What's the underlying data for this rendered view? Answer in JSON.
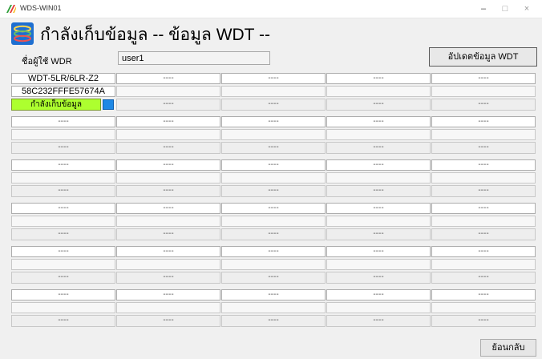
{
  "window": {
    "title": "WDS-WIN01",
    "minimize": "–",
    "maximize": "□",
    "close": "×"
  },
  "header": {
    "icon": "stacked-rings-icon",
    "title": "กำลังเก็บข้อมูล -- ข้อมูล WDT --"
  },
  "user": {
    "label": "ชื่อผู้ใช้ WDR",
    "value": "user1"
  },
  "toolbar": {
    "update_label": "อัปเดตข้อมูล WDT"
  },
  "status": {
    "collecting": "กำลังเก็บข้อมูล",
    "indicator_color": "#1e88e5",
    "bar_color": "#adff2f"
  },
  "devices": [
    [
      "WDT-5LR/6LR-Z2",
      "58C232FFFE57674A",
      ""
    ],
    [
      "----",
      "",
      "----"
    ],
    [
      "----",
      "",
      "----"
    ],
    [
      "----",
      "",
      "----"
    ],
    [
      "----",
      "",
      "----"
    ],
    [
      "----",
      "",
      "----"
    ],
    [
      "----",
      "",
      "----"
    ],
    [
      "----",
      "",
      "----"
    ],
    [
      "----",
      "",
      "----"
    ],
    [
      "----",
      "",
      "----"
    ],
    [
      "----",
      "",
      "----"
    ],
    [
      "----",
      "",
      "----"
    ],
    [
      "----",
      "",
      "----"
    ],
    [
      "----",
      "",
      "----"
    ],
    [
      "----",
      "",
      "----"
    ],
    [
      "----",
      "",
      "----"
    ],
    [
      "----",
      "",
      "----"
    ],
    [
      "----",
      "",
      "----"
    ],
    [
      "----",
      "",
      "----"
    ],
    [
      "----",
      "",
      "----"
    ],
    [
      "----",
      "",
      "----"
    ],
    [
      "----",
      "",
      "----"
    ],
    [
      "----",
      "",
      "----"
    ],
    [
      "----",
      "",
      "----"
    ],
    [
      "----",
      "",
      "----"
    ],
    [
      "----",
      "",
      "----"
    ],
    [
      "----",
      "",
      "----"
    ],
    [
      "----",
      "",
      "----"
    ],
    [
      "----",
      "",
      "----"
    ],
    [
      "----",
      "",
      "----"
    ]
  ],
  "footer": {
    "back_label": "ย้อนกลับ"
  }
}
